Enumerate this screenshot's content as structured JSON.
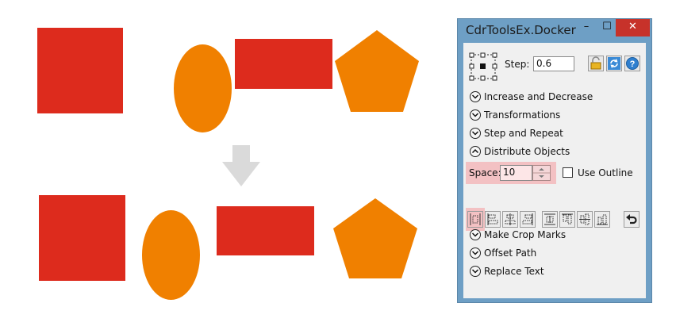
{
  "colors": {
    "red": "#dd2b1d",
    "orange": "#f08000",
    "arrow": "#dadada",
    "highlight": "#f3c1c3",
    "window_frame": "#6e9fc5",
    "close_button": "#c7322a"
  },
  "canvas": {
    "arrow_icon": "arrow-down-icon",
    "top_row": [
      "red-square",
      "orange-ellipse",
      "red-rectangle",
      "orange-pentagon"
    ],
    "bottom_row": [
      "red-square",
      "orange-ellipse",
      "red-rectangle",
      "orange-pentagon"
    ]
  },
  "docker": {
    "title": "CdrToolsEx.Docker",
    "minimize_symbol": "–",
    "maximize_symbol": "☐",
    "close_symbol": "✕",
    "step_label": "Step:",
    "step_value": "0.6",
    "header_icons": [
      "lock-icon",
      "refresh-icon",
      "help-icon"
    ],
    "sections_top": [
      {
        "label": "Increase and Decrease",
        "state": "collapsed"
      },
      {
        "label": "Transformations",
        "state": "collapsed"
      },
      {
        "label": "Step and Repeat",
        "state": "collapsed"
      },
      {
        "label": "Distribute Objects",
        "state": "expanded"
      }
    ],
    "space_label": "Space:",
    "space_value": "10",
    "use_outline_label": "Use Outline",
    "use_outline_checked": false,
    "distribute_tools": [
      "distribute-horizontal-spacing-icon",
      "distribute-left-icon",
      "distribute-center-icon",
      "distribute-right-icon",
      "distribute-vertical-spacing-icon",
      "distribute-top-icon",
      "distribute-middle-icon",
      "distribute-bottom-icon",
      "undo-icon"
    ],
    "sections_bottom": [
      {
        "label": "Make Crop Marks",
        "state": "collapsed"
      },
      {
        "label": "Offset Path",
        "state": "collapsed"
      },
      {
        "label": "Replace Text",
        "state": "collapsed"
      }
    ]
  }
}
